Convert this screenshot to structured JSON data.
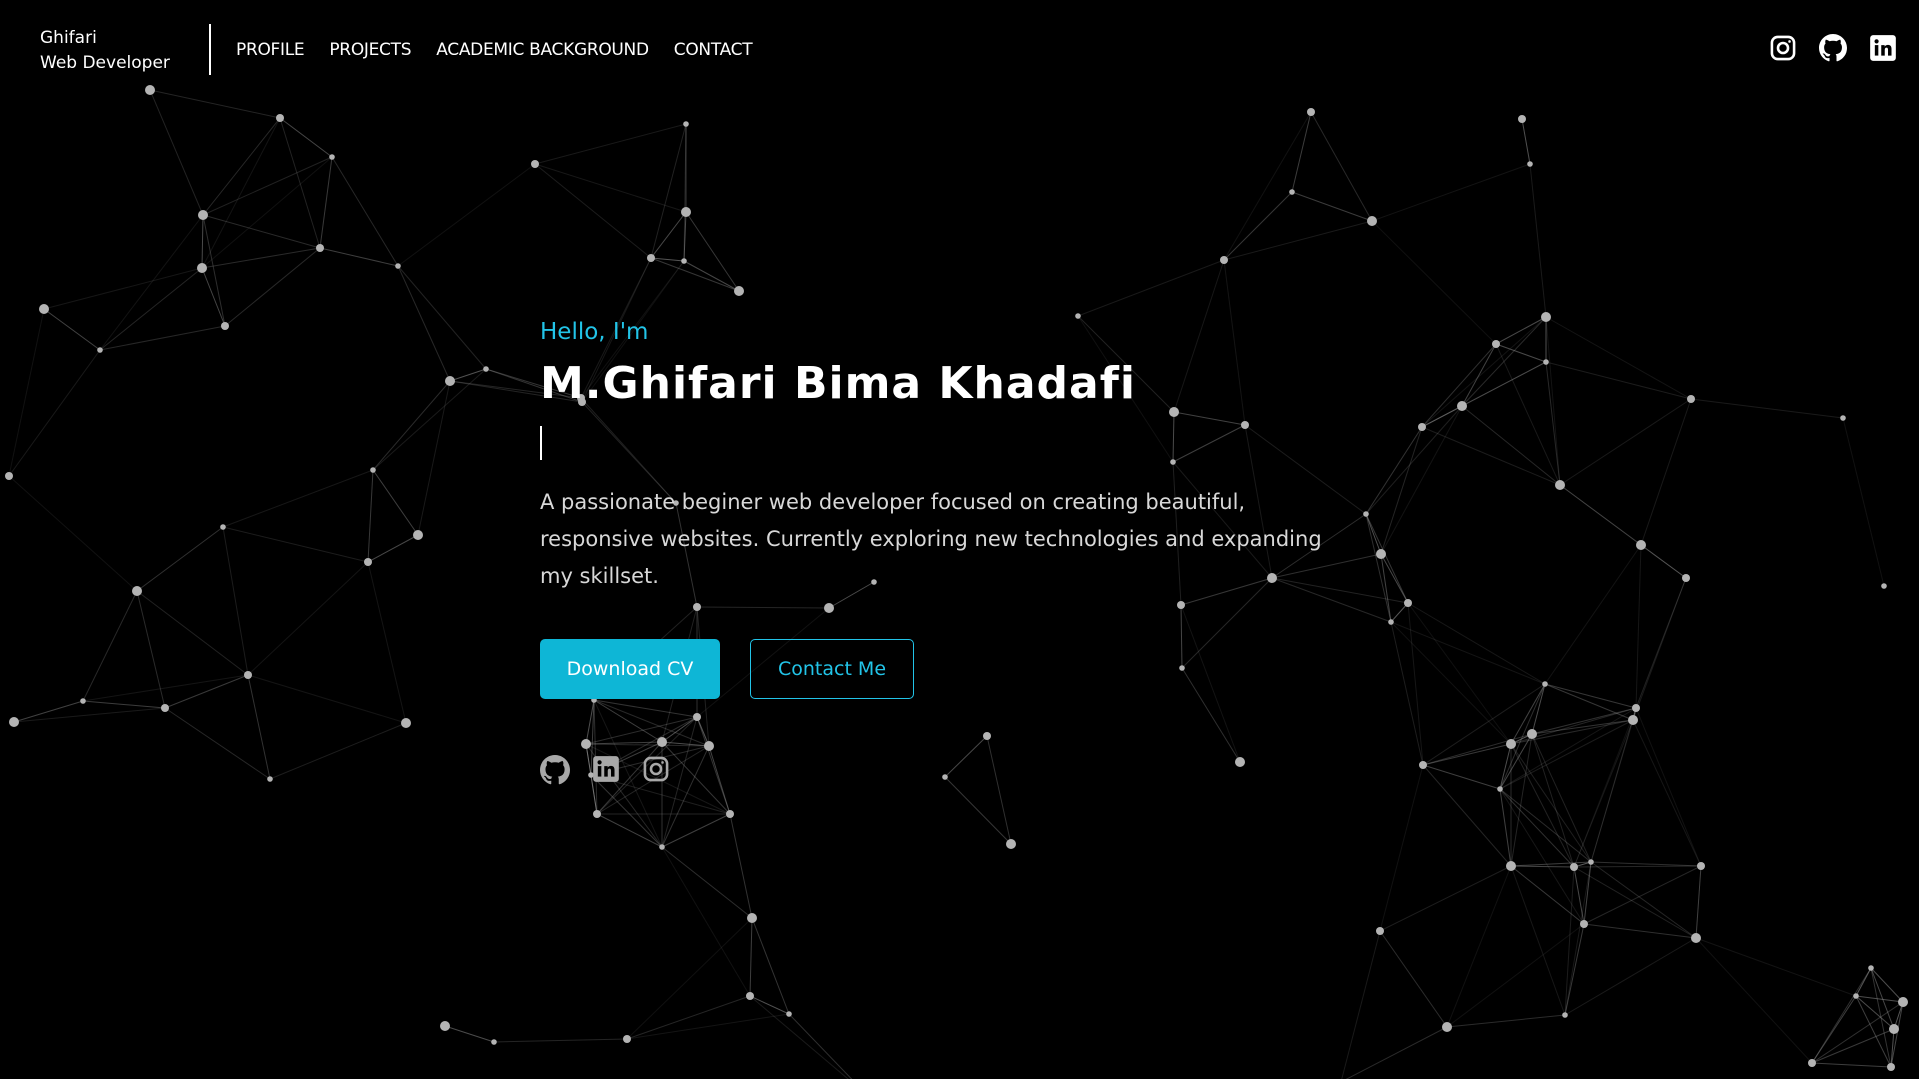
{
  "brand": {
    "name": "Ghifari",
    "role": "Web Developer"
  },
  "nav": {
    "items": [
      {
        "label": "PROFILE"
      },
      {
        "label": "PROJECTS"
      },
      {
        "label": "ACADEMIC BACKGROUND"
      },
      {
        "label": "CONTACT"
      }
    ]
  },
  "social_top": [
    "instagram-icon",
    "github-icon",
    "linkedin-icon"
  ],
  "hero": {
    "greeting": "Hello, I'm",
    "name": "M.Ghifari Bima Khadafi",
    "description": "A passionate beginer web developer focused on creating beautiful, responsive websites. Currently exploring new technologies and expanding my skillset.",
    "primary_button": "Download CV",
    "secondary_button": "Contact Me"
  },
  "social_hero": [
    "github-icon",
    "linkedin-icon",
    "instagram-icon"
  ],
  "colors": {
    "background": "#000000",
    "accent": "#22c4e8",
    "button_primary": "#0eb6d6",
    "text": "#ffffff",
    "muted_text": "#d8d8d8",
    "network": "#9a9a9a"
  }
}
